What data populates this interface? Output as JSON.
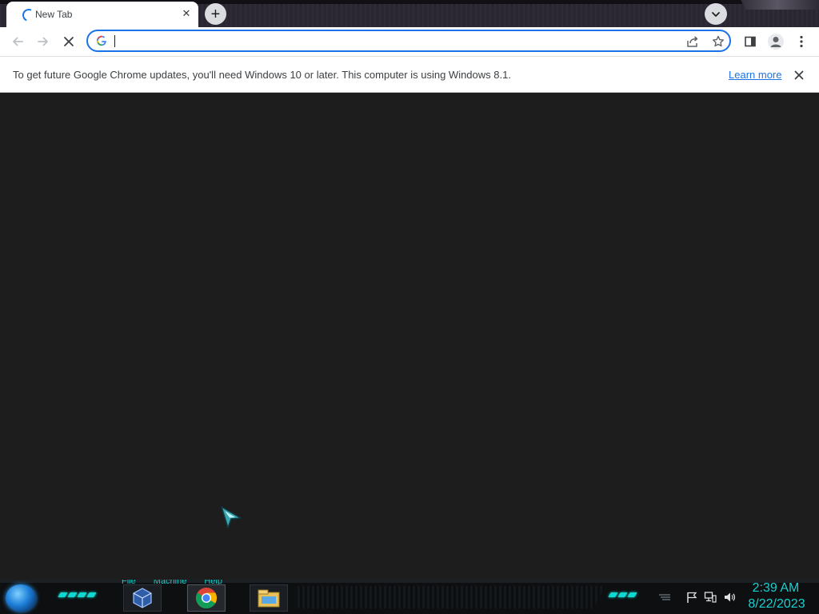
{
  "browser": {
    "tab": {
      "title": "New Tab",
      "close_label": "✕"
    },
    "new_tab_label": "+",
    "omnibox": {
      "value": "",
      "placeholder": ""
    },
    "infobar": {
      "message": "To get future Google Chrome updates, you'll need Windows 10 or later. This computer is using Windows 8.1.",
      "link": "Learn more"
    },
    "colors": {
      "accent": "#1a73e8",
      "content_bg": "#1d1d1d",
      "tabstrip_bg": "#2a2733"
    }
  },
  "taskbar": {
    "vbox_menu": [
      "File",
      "Machine",
      "Help"
    ],
    "pinned_apps": [
      "virtualbox-icon",
      "chrome-icon",
      "file-explorer-icon"
    ],
    "tray_icons": [
      "action-center-flag-icon",
      "network-icon",
      "volume-icon"
    ],
    "clock": {
      "time": "2:39 AM",
      "date": "8/22/2023"
    },
    "accent_color": "#18d0d0"
  }
}
